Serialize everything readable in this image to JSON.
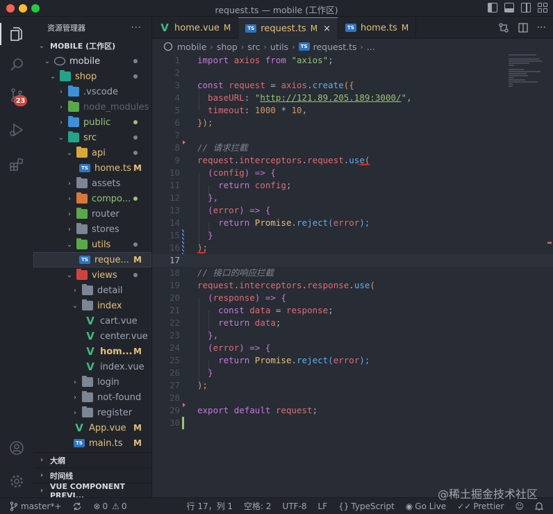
{
  "window": {
    "title": "request.ts — mobile (工作区)"
  },
  "activity_bar": {
    "badge_count": "23",
    "icons": [
      "files-icon",
      "search-icon",
      "source-control-icon",
      "run-debug-icon",
      "extensions-icon",
      "account-icon",
      "settings-gear-icon"
    ]
  },
  "sidebar": {
    "title": "资源管理器",
    "more": "···",
    "workspace": "MOBILE (工作区)",
    "tree": {
      "mobile": "mobile",
      "shop": "shop",
      "vscode": ".vscode",
      "node_modules": "node_modules",
      "public": "public",
      "src": "src",
      "api": "api",
      "home_ts": "home.ts",
      "assets": "assets",
      "components": "compo...",
      "router": "router",
      "stores": "stores",
      "utils": "utils",
      "request_ts": "reque...",
      "views": "views",
      "detail": "detail",
      "index": "index",
      "cart_vue": "cart.vue",
      "center_vue": "center.vue",
      "home_vue": "hom...",
      "index_vue": "index.vue",
      "login": "login",
      "not_found": "not-found",
      "register": "register",
      "app_vue": "App.vue",
      "main_ts": "main.ts",
      "mod_letter": "M"
    },
    "sections": {
      "outline": "大纲",
      "timeline": "时间线",
      "vue_preview": "VUE COMPONENT PREVI..."
    }
  },
  "tabs": [
    {
      "label": "home.vue",
      "status": "M"
    },
    {
      "label": "request.ts",
      "status": "M",
      "close": "×"
    },
    {
      "label": "home.ts",
      "status": "M"
    }
  ],
  "breadcrumb": [
    "mobile",
    "shop",
    "src",
    "utils",
    "request.ts",
    "..."
  ],
  "editor": {
    "line_numbers": [
      "1",
      "2",
      "3",
      "4",
      "5",
      "6",
      "7",
      "8",
      "9",
      "10",
      "11",
      "12",
      "13",
      "14",
      "15",
      "16",
      "17",
      "18",
      "19",
      "20",
      "21",
      "22",
      "23",
      "24",
      "25",
      "26",
      "27",
      "28",
      "29",
      "30"
    ],
    "tokens": {
      "import": "import",
      "axios": "axios",
      "from": "from",
      "axios_str": "\"axios\"",
      "semi": ";",
      "const": "const",
      "request": "request",
      "eq": " = ",
      "create": "create",
      "open_obj": "({",
      "baseURL": "baseURL",
      "colon": ": ",
      "url_q": "\"",
      "url": "http://121.89.205.189:3000/",
      "comma": ",",
      "timeout": "timeout",
      "n1000": "1000",
      "times": " * ",
      "n10": "10",
      "close_obj": "});",
      "c1": "// 请求拦截",
      "interceptors": "interceptors",
      "request_prop": "request",
      "response_prop": "response",
      "use": "use",
      "open_paren": "(",
      "config": "config",
      "arrow": " => {",
      "return": "return",
      "close_brace_comma": "},",
      "error": "error",
      "Promise": "Promise",
      "reject": "reject",
      "close_brace": "}",
      "close_paren_semi": ");",
      "c2": "// 接口的响应拦截",
      "response": "response",
      "data": "data",
      "export": "export",
      "default": "default"
    }
  },
  "statusbar": {
    "branch": "master*+",
    "errors": "0",
    "warnings": "0",
    "position": "行 17，列 1",
    "spaces": "空格: 2",
    "encoding": "UTF-8",
    "eol": "LF",
    "language": "TypeScript",
    "golive": "Go Live",
    "prettier": "Prettier"
  },
  "watermark": "@稀土掘金技术社区"
}
